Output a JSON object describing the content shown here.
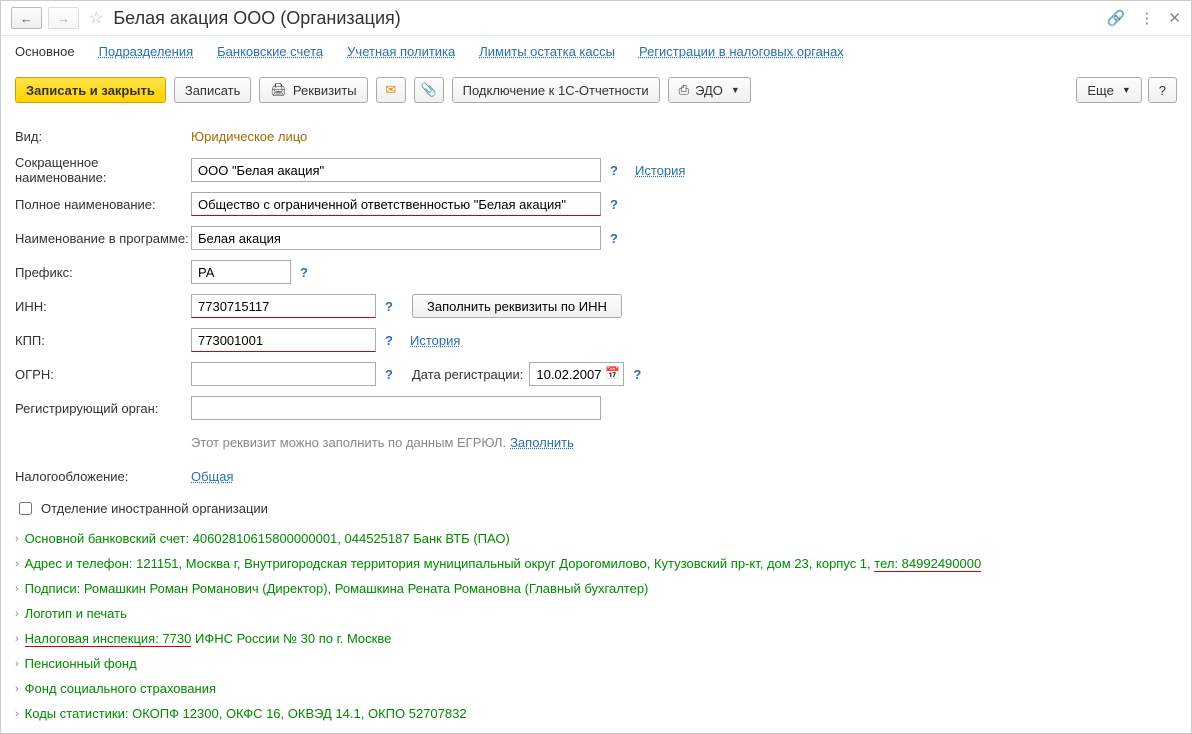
{
  "title": "Белая акация ООО (Организация)",
  "tabs": {
    "main": "Основное",
    "divisions": "Подразделения",
    "bank": "Банковские счета",
    "accounting": "Учетная политика",
    "limits": "Лимиты остатка кассы",
    "tax": "Регистрации в налоговых органах"
  },
  "toolbar": {
    "save_close": "Записать и закрыть",
    "save": "Записать",
    "requisites": "Реквизиты",
    "connect_1c": "Подключение к 1С-Отчетности",
    "edo": "ЭДО",
    "more": "Еще",
    "help": "?"
  },
  "form": {
    "type_label": "Вид:",
    "type_value": "Юридическое лицо",
    "short_name_label": "Сокращенное наименование:",
    "short_name_value": "ООО \"Белая акация\"",
    "history": "История",
    "full_name_label": "Полное наименование:",
    "full_name_value": "Общество с ограниченной ответственностью \"Белая акация\"",
    "program_name_label": "Наименование в программе:",
    "program_name_value": "Белая акация",
    "prefix_label": "Префикс:",
    "prefix_value": "РА",
    "inn_label": "ИНН:",
    "inn_value": "7730715117",
    "fill_by_inn": "Заполнить реквизиты по ИНН",
    "kpp_label": "КПП:",
    "kpp_value": "773001001",
    "ogrn_label": "ОГРН:",
    "ogrn_value": "",
    "reg_date_label": "Дата регистрации:",
    "reg_date_value": "10.02.2007",
    "reg_org_label": "Регистрирующий орган:",
    "reg_org_value": "",
    "egrul_note": "Этот реквизит можно заполнить по данным ЕГРЮЛ.",
    "fill_link": "Заполнить",
    "tax_mode_label": "Налогообложение:",
    "tax_mode_value": "Общая",
    "foreign_cb": "Отделение иностранной организации"
  },
  "sections": {
    "bank": "Основной банковский счет: 40602810615800000001, 044525187 Банк ВТБ (ПАО)",
    "address_prefix": "Адрес и телефон: 121151, Москва г, Внутригородская территория муниципальный округ Дорогомилово, Кутузовский пр-кт, дом 23, корпус 1, ",
    "address_phone": "тел: 84992490000",
    "signatures": "Подписи: Ромашкин Роман Романович (Директор), Ромашкина Рената Романовна (Главный бухгалтер)",
    "logo": "Логотип и печать",
    "tax_insp_prefix": "Налоговая инспекция: 7730",
    "tax_insp_suffix": " ИФНС России № 30 по г. Москве",
    "pension": "Пенсионный фонд",
    "social": "Фонд социального страхования",
    "stats": "Коды статистики: ОКОПФ 12300, ОКФС 16, ОКВЭД 14.1, ОКПО 52707832"
  }
}
